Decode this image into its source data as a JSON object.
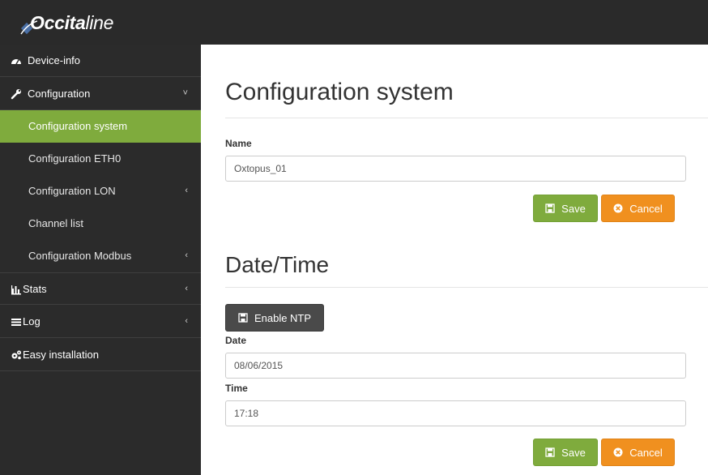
{
  "app": {
    "logo_bold": "Occita",
    "logo_light": "line"
  },
  "sidebar": {
    "items": [
      {
        "label": "Device-info",
        "icon": "dashboard-icon"
      },
      {
        "label": "Configuration",
        "icon": "wrench-icon",
        "chevron": "˅"
      },
      {
        "label": "Configuration system",
        "active": true
      },
      {
        "label": "Configuration ETH0"
      },
      {
        "label": "Configuration LON",
        "chevron": "‹"
      },
      {
        "label": "Channel list"
      },
      {
        "label": "Configuration Modbus",
        "chevron": "‹"
      },
      {
        "label": "Stats",
        "icon": "bar-chart-icon",
        "chevron": "‹"
      },
      {
        "label": "Log",
        "icon": "list-icon",
        "chevron": "‹"
      },
      {
        "label": "Easy installation",
        "icon": "cogs-icon"
      }
    ]
  },
  "main": {
    "title": "Configuration system",
    "name_label": "Name",
    "name_value": "Oxtopus_01",
    "save_label": "Save",
    "cancel_label": "Cancel",
    "datetime_title": "Date/Time",
    "ntp_label": "Enable NTP",
    "date_label": "Date",
    "date_value": "08/06/2015",
    "time_label": "Time",
    "time_value": "17:18",
    "save2_label": "Save",
    "cancel2_label": "Cancel"
  },
  "colors": {
    "topbar": "#2a2a2a",
    "sidebar": "#2b2b2b",
    "accent_green": "#7fab3d",
    "accent_orange": "#f0901f",
    "ntp_button": "#4a4a4a"
  }
}
